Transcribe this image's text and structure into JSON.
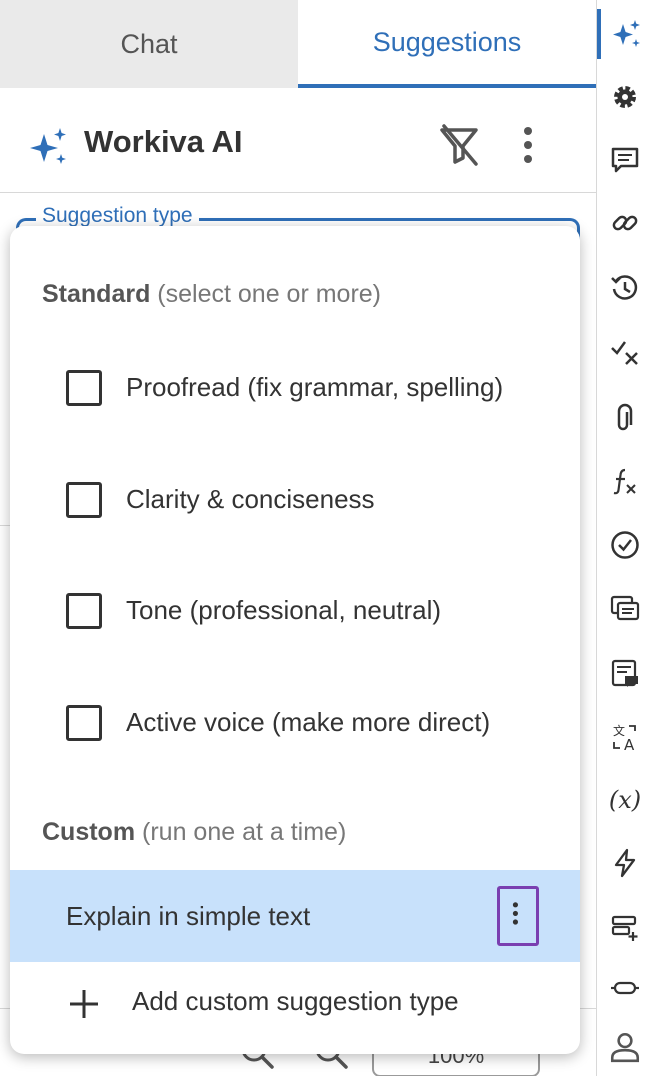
{
  "tabs": [
    {
      "label": "Chat"
    },
    {
      "label": "Suggestions"
    }
  ],
  "header": {
    "title": "Workiva AI",
    "filter_icon": "filter-off-icon",
    "more_icon": "more-vertical-icon"
  },
  "select": {
    "legend": "Suggestion type"
  },
  "dropdown": {
    "standard_heading": "Standard",
    "standard_hint": " (select one or more)",
    "options": [
      {
        "label": "Proofread (fix grammar, spelling)",
        "checked": false
      },
      {
        "label": "Clarity & conciseness",
        "checked": false
      },
      {
        "label": "Tone (professional, neutral)",
        "checked": false
      },
      {
        "label": "Active voice (make more direct)",
        "checked": false
      }
    ],
    "custom_heading": "Custom",
    "custom_hint": " (run one at a time)",
    "custom_items": [
      {
        "label": "Explain in simple text"
      }
    ],
    "add_label": "Add custom suggestion type"
  },
  "zoom": {
    "value": "100%"
  },
  "colors": {
    "accent": "#2f6fb8",
    "highlight": "#c8e1fb",
    "focus_outline": "#7a3fb0"
  }
}
